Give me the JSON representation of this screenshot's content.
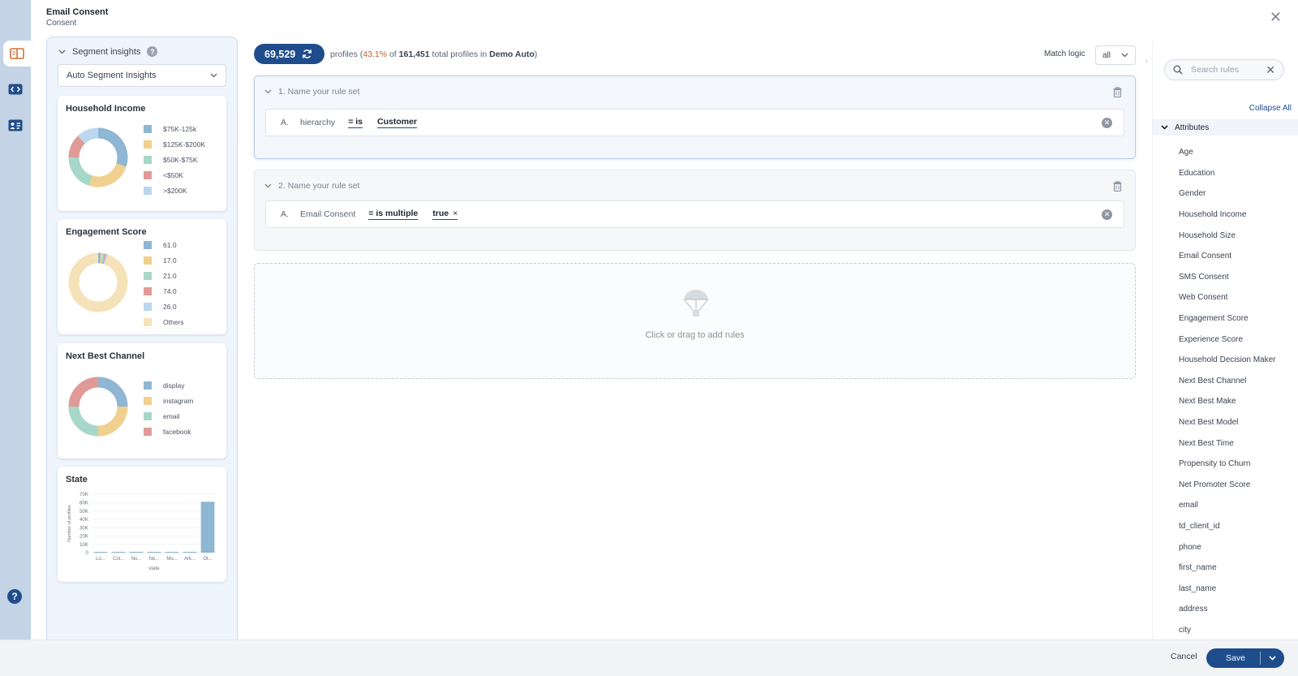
{
  "header": {
    "title": "Email Consent",
    "subtitle": "Consent"
  },
  "insights": {
    "heading": "Segment insights",
    "selector_value": "Auto Segment Insights",
    "cards": {
      "household_income": {
        "title": "Household Income",
        "legend": [
          "$75K-125k",
          "$125K-$200K",
          "$50K-$75K",
          "<$50K",
          ">$200K"
        ]
      },
      "engagement_score": {
        "title": "Engagement Score",
        "legend": [
          "61.0",
          "17.0",
          "21.0",
          "74.0",
          "26.0",
          "Others"
        ]
      },
      "next_best_channel": {
        "title": "Next Best Channel",
        "legend": [
          "display",
          "instagram",
          "email",
          "facebook"
        ]
      },
      "state": {
        "title": "State",
        "ylabel": "Number of profiles",
        "xlabel": "state"
      }
    }
  },
  "chart_data": [
    {
      "type": "pie",
      "title": "Household Income",
      "categories": [
        "$75K-125k",
        "$125K-$200K",
        "$50K-$75K",
        "<$50K",
        ">$200K"
      ],
      "values": [
        30,
        25,
        20,
        13,
        12
      ],
      "colors": [
        "#8fb6d2",
        "#f0d08e",
        "#a7d7c8",
        "#e09a96",
        "#bcd6ee"
      ]
    },
    {
      "type": "pie",
      "title": "Engagement Score",
      "categories": [
        "61.0",
        "17.0",
        "21.0",
        "74.0",
        "26.0",
        "Others"
      ],
      "values": [
        1.5,
        1,
        1,
        1,
        1,
        94.5
      ],
      "colors": [
        "#8fb6d2",
        "#f0d08e",
        "#a7d7c8",
        "#e09a96",
        "#bcd6ee",
        "#f6e2b8"
      ]
    },
    {
      "type": "pie",
      "title": "Next Best Channel",
      "categories": [
        "display",
        "instagram",
        "email",
        "facebook"
      ],
      "values": [
        25,
        25,
        25,
        25
      ],
      "colors": [
        "#8fb6d2",
        "#f0d08e",
        "#a7d7c8",
        "#e09a96"
      ]
    },
    {
      "type": "bar",
      "title": "State",
      "ylabel": "Number of profiles",
      "xlabel": "state",
      "categories": [
        "Lo...",
        "Col...",
        "No...",
        "Ne...",
        "Mo...",
        "Ark...",
        "Ot..."
      ],
      "values": [
        1000,
        1000,
        1000,
        1000,
        1000,
        1000,
        61000
      ],
      "ylim": [
        0,
        70000
      ],
      "yticks": [
        "70K",
        "60K",
        "50K",
        "40K",
        "30K",
        "20K",
        "10K",
        "0"
      ],
      "color": "#8fb6d2"
    }
  ],
  "summary": {
    "count": "69,529",
    "text_profiles": "profiles (",
    "percent": "43.1%",
    "text_of": " of ",
    "total": "161,451",
    "text_total": " total profiles in ",
    "source": "Demo Auto",
    "text_close": ")"
  },
  "match_logic": {
    "label": "Match logic",
    "value": "all"
  },
  "rulesets": [
    {
      "title": "1.  Name your rule set",
      "rule": {
        "letter": "A.",
        "attribute": "hierarchy",
        "operator": "= is",
        "value": "Customer"
      }
    },
    {
      "title": "2.  Name your rule set",
      "rule": {
        "letter": "A.",
        "attribute": "Email Consent",
        "operator": "= is multiple",
        "value": "true",
        "value_remove": "×"
      }
    }
  ],
  "dropzone": {
    "text": "Click or drag to add rules"
  },
  "attributes_panel": {
    "search_placeholder": "Search rules",
    "collapse_all": "Collapse All",
    "group": "Attributes",
    "items": [
      "Age",
      "Education",
      "Gender",
      "Household Income",
      "Household Size",
      "Email Consent",
      "SMS Consent",
      "Web Consent",
      "Engagement Score",
      "Experience Score",
      "Household Decision Maker",
      "Next Best Channel",
      "Next Best Make",
      "Next Best Model",
      "Next Best Time",
      "Propensity to Churn",
      "Net Promoter Score",
      "email",
      "td_client_id",
      "phone",
      "first_name",
      "last_name",
      "address",
      "city"
    ]
  },
  "footer": {
    "cancel": "Cancel",
    "save": "Save"
  }
}
